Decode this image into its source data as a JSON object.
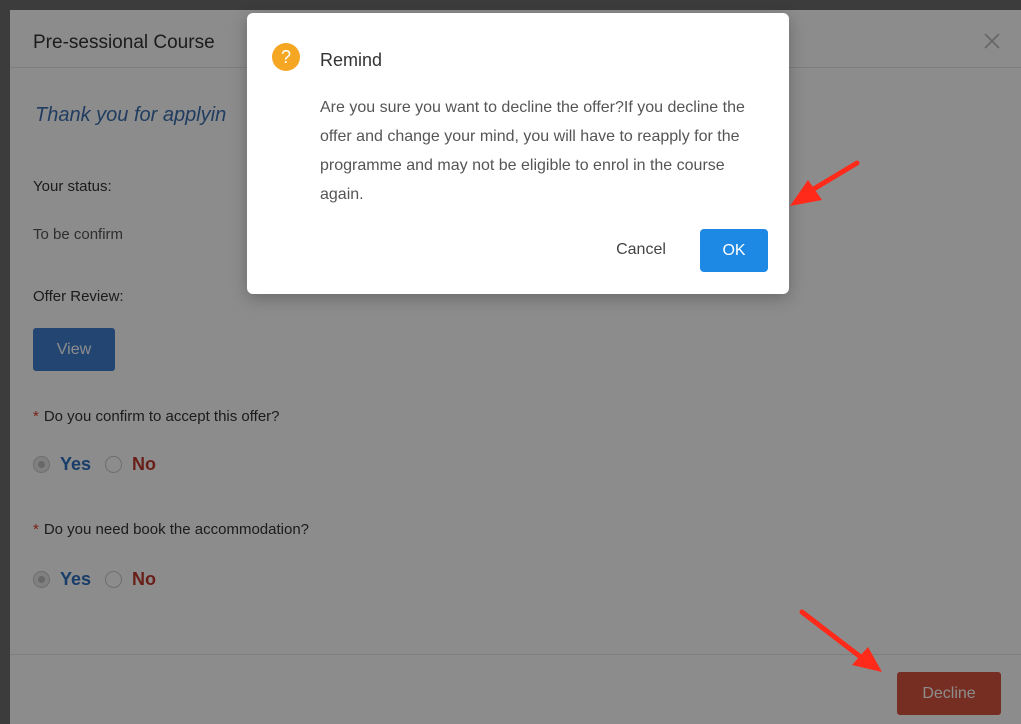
{
  "window": {
    "title": "Pre-sessional Course",
    "thanks_text": "Thank you for applyin",
    "status_label": "Your status:",
    "status_value": "To be confirm",
    "offer_review_label": "Offer Review:",
    "view_button": "View",
    "question_accept": "Do you confirm to accept this offer?",
    "question_accommodation": "Do you need book the accommodation?",
    "required_mark": "*",
    "yes_label": "Yes",
    "no_label": "No",
    "decline_button": "Decline"
  },
  "dialog": {
    "title": "Remind",
    "icon_glyph": "?",
    "message": "Are you sure you want to decline the offer?If you decline the offer and change your mind, you will have to reapply for the programme and may not be eligible to enrol in the course again.",
    "cancel_label": "Cancel",
    "ok_label": "OK"
  },
  "colors": {
    "ok_button": "#1e88e5",
    "decline_button": "#d9553f",
    "warn_icon": "#f5a623",
    "annotation_arrow": "#ff2a1a"
  }
}
